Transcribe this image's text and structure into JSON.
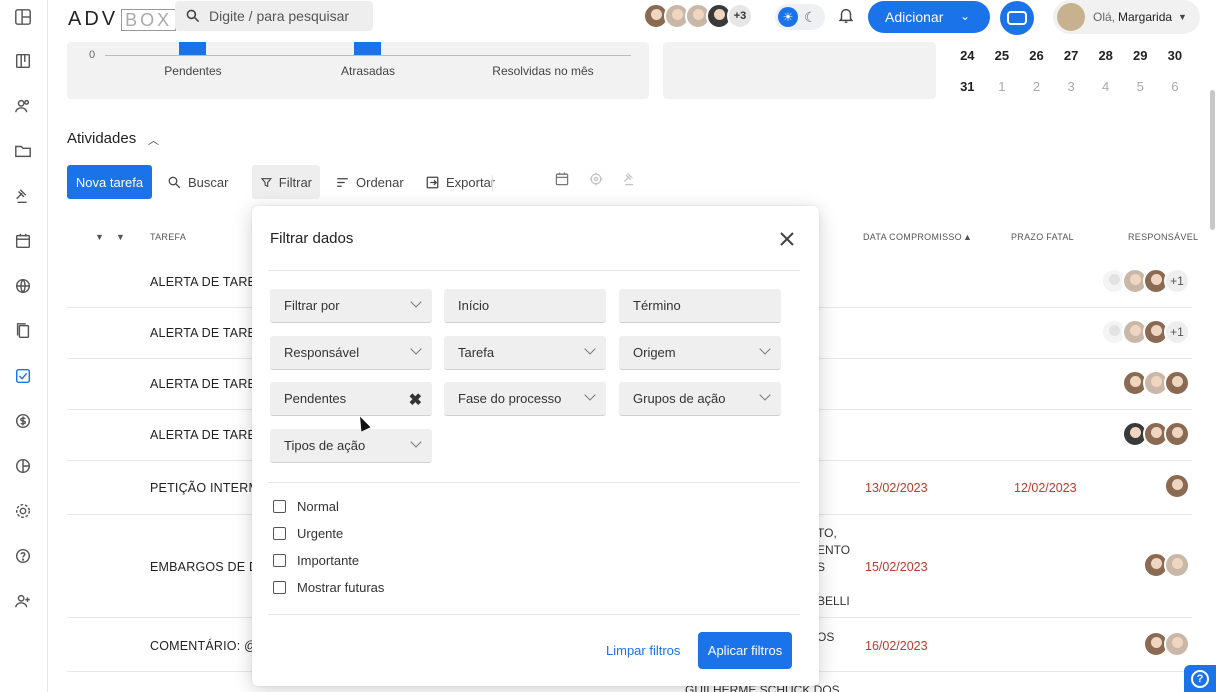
{
  "app": {
    "logo_text": "ADV",
    "logo_box": "BOX",
    "search_placeholder": "Digite / para pesquisar",
    "avatars_extra": "+3",
    "add_button": "Adicionar",
    "greeting": "Olá,",
    "user_name": "Margarida"
  },
  "sidebar": {
    "items": [
      "layout-icon",
      "board-icon",
      "people-icon",
      "folder-icon",
      "gavel-icon",
      "calendar-icon",
      "globe-icon",
      "documents-icon",
      "tasks-icon",
      "money-icon",
      "chart-icon",
      "settings-icon",
      "help-icon",
      "add-user-icon"
    ],
    "active": "tasks-icon"
  },
  "summary": {
    "zero_tick": "0",
    "labels": [
      "Pendentes",
      "Atrasadas",
      "Resolvidas no mês"
    ]
  },
  "calendar": {
    "rows": [
      [
        {
          "d": "24"
        },
        {
          "d": "25"
        },
        {
          "d": "26"
        },
        {
          "d": "27"
        },
        {
          "d": "28"
        },
        {
          "d": "29"
        },
        {
          "d": "30"
        }
      ],
      [
        {
          "d": "31"
        },
        {
          "d": "1",
          "m": true
        },
        {
          "d": "2",
          "m": true
        },
        {
          "d": "3",
          "m": true
        },
        {
          "d": "4",
          "m": true
        },
        {
          "d": "5",
          "m": true
        },
        {
          "d": "6",
          "m": true
        }
      ]
    ]
  },
  "activities": {
    "title": "Atividades",
    "new_task": "Nova tarefa",
    "search": "Buscar",
    "filter": "Filtrar",
    "sort": "Ordenar",
    "export": "Exportar",
    "columns": {
      "task": "TAREFA",
      "date": "DATA COMPROMISSO",
      "deadline": "PRAZO FATAL",
      "responsible": "RESPONSÁVEL"
    },
    "rows": [
      {
        "task": "ALERTA DE TAREI",
        "date": "",
        "deadline": "",
        "avatars": "+1"
      },
      {
        "task": "ALERTA DE TAREI",
        "date": "",
        "deadline": "",
        "avatars": "+1"
      },
      {
        "task": "ALERTA DE TAREI",
        "date": "",
        "deadline": ""
      },
      {
        "task": "ALERTA DE TAREI",
        "date": "",
        "deadline": ""
      },
      {
        "task": "PETIÇÃO INTERM",
        "date": "13/02/2023",
        "deadline": "12/02/2023"
      },
      {
        "task": "EMBARGOS DE D",
        "date": "15/02/2023",
        "deadline": "",
        "extra": [
          "TO,",
          "ENTO",
          "S",
          "",
          "BELLI"
        ]
      },
      {
        "task": "COMENTÁRIO: @:",
        "date": "16/02/2023",
        "deadline": "",
        "extra": [
          "OS"
        ]
      }
    ],
    "overflow_text": "GUILHERME SCHUCK DOS"
  },
  "modal": {
    "title": "Filtrar dados",
    "fields": {
      "filter_by": "Filtrar por",
      "start": "Início",
      "end": "Término",
      "responsible": "Responsável",
      "task": "Tarefa",
      "origin": "Origem",
      "status": "Pendentes",
      "phase": "Fase do processo",
      "action_groups": "Grupos de ação",
      "action_types": "Tipos de ação"
    },
    "checkboxes": [
      "Normal",
      "Urgente",
      "Importante",
      "Mostrar futuras"
    ],
    "clear": "Limpar filtros",
    "apply": "Aplicar filtros"
  }
}
